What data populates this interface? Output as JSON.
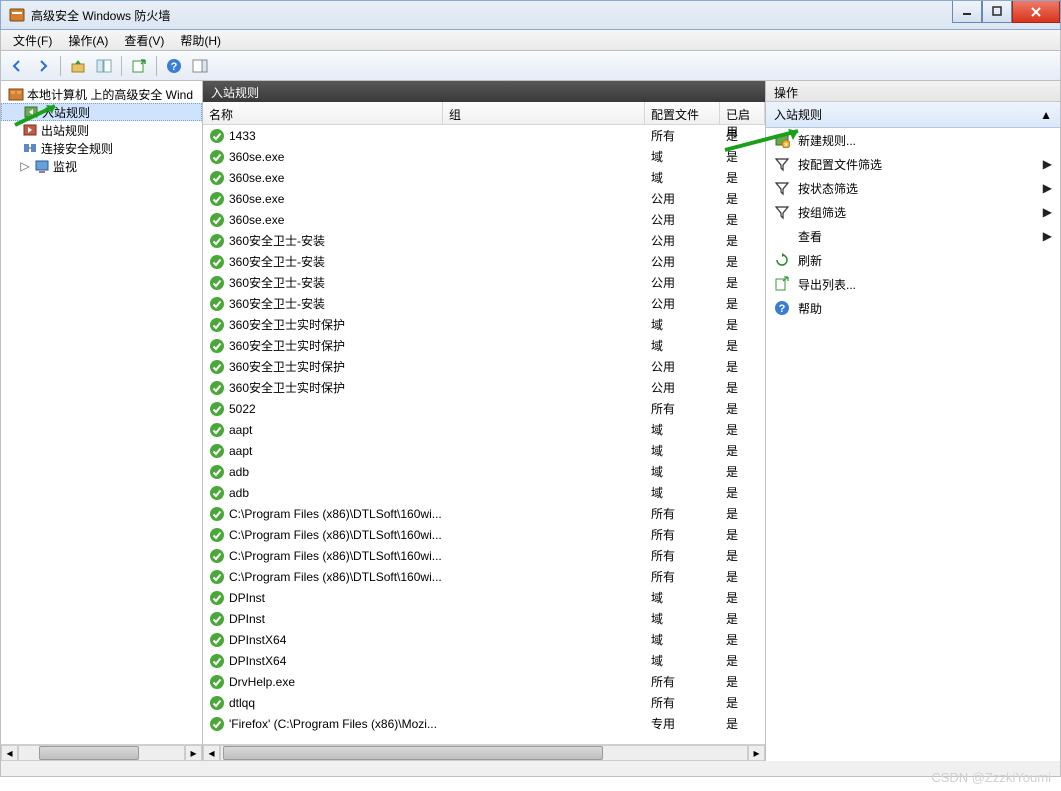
{
  "window": {
    "title": "高级安全 Windows 防火墙"
  },
  "menu": {
    "file": "文件(F)",
    "action": "操作(A)",
    "view": "查看(V)",
    "help": "帮助(H)"
  },
  "tree": {
    "root": "本地计算机 上的高级安全 Wind",
    "inbound": "入站规则",
    "outbound": "出站规则",
    "connsec": "连接安全规则",
    "monitor": "监视"
  },
  "center": {
    "title": "入站规则",
    "cols": {
      "name": "名称",
      "group": "组",
      "profile": "配置文件",
      "enabled": "已启用"
    },
    "rows": [
      {
        "name": "1433",
        "group": "",
        "profile": "所有",
        "enabled": "是"
      },
      {
        "name": "360se.exe",
        "group": "",
        "profile": "域",
        "enabled": "是"
      },
      {
        "name": "360se.exe",
        "group": "",
        "profile": "域",
        "enabled": "是"
      },
      {
        "name": "360se.exe",
        "group": "",
        "profile": "公用",
        "enabled": "是"
      },
      {
        "name": "360se.exe",
        "group": "",
        "profile": "公用",
        "enabled": "是"
      },
      {
        "name": "360安全卫士-安装",
        "group": "",
        "profile": "公用",
        "enabled": "是"
      },
      {
        "name": "360安全卫士-安装",
        "group": "",
        "profile": "公用",
        "enabled": "是"
      },
      {
        "name": "360安全卫士-安装",
        "group": "",
        "profile": "公用",
        "enabled": "是"
      },
      {
        "name": "360安全卫士-安装",
        "group": "",
        "profile": "公用",
        "enabled": "是"
      },
      {
        "name": "360安全卫士实时保护",
        "group": "",
        "profile": "域",
        "enabled": "是"
      },
      {
        "name": "360安全卫士实时保护",
        "group": "",
        "profile": "域",
        "enabled": "是"
      },
      {
        "name": "360安全卫士实时保护",
        "group": "",
        "profile": "公用",
        "enabled": "是"
      },
      {
        "name": "360安全卫士实时保护",
        "group": "",
        "profile": "公用",
        "enabled": "是"
      },
      {
        "name": "5022",
        "group": "",
        "profile": "所有",
        "enabled": "是"
      },
      {
        "name": "aapt",
        "group": "",
        "profile": "域",
        "enabled": "是"
      },
      {
        "name": "aapt",
        "group": "",
        "profile": "域",
        "enabled": "是"
      },
      {
        "name": "adb",
        "group": "",
        "profile": "域",
        "enabled": "是"
      },
      {
        "name": "adb",
        "group": "",
        "profile": "域",
        "enabled": "是"
      },
      {
        "name": "C:\\Program Files (x86)\\DTLSoft\\160wi...",
        "group": "",
        "profile": "所有",
        "enabled": "是"
      },
      {
        "name": "C:\\Program Files (x86)\\DTLSoft\\160wi...",
        "group": "",
        "profile": "所有",
        "enabled": "是"
      },
      {
        "name": "C:\\Program Files (x86)\\DTLSoft\\160wi...",
        "group": "",
        "profile": "所有",
        "enabled": "是"
      },
      {
        "name": "C:\\Program Files (x86)\\DTLSoft\\160wi...",
        "group": "",
        "profile": "所有",
        "enabled": "是"
      },
      {
        "name": "DPInst",
        "group": "",
        "profile": "域",
        "enabled": "是"
      },
      {
        "name": "DPInst",
        "group": "",
        "profile": "域",
        "enabled": "是"
      },
      {
        "name": "DPInstX64",
        "group": "",
        "profile": "域",
        "enabled": "是"
      },
      {
        "name": "DPInstX64",
        "group": "",
        "profile": "域",
        "enabled": "是"
      },
      {
        "name": "DrvHelp.exe",
        "group": "",
        "profile": "所有",
        "enabled": "是"
      },
      {
        "name": "dtlqq",
        "group": "",
        "profile": "所有",
        "enabled": "是"
      },
      {
        "name": "'Firefox' (C:\\Program Files (x86)\\Mozi...",
        "group": "",
        "profile": "专用",
        "enabled": "是"
      }
    ]
  },
  "actions": {
    "title": "操作",
    "section": "入站规则",
    "newrule": "新建规则...",
    "filter_profile": "按配置文件筛选",
    "filter_state": "按状态筛选",
    "filter_group": "按组筛选",
    "view": "查看",
    "refresh": "刷新",
    "export": "导出列表...",
    "help": "帮助"
  },
  "watermark": "CSDN @ZzzkiYoumi"
}
